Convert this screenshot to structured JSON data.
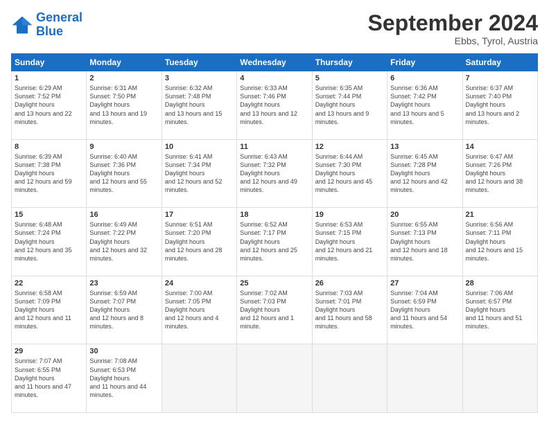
{
  "header": {
    "logo_line1": "General",
    "logo_line2": "Blue",
    "month": "September 2024",
    "location": "Ebbs, Tyrol, Austria"
  },
  "days_of_week": [
    "Sunday",
    "Monday",
    "Tuesday",
    "Wednesday",
    "Thursday",
    "Friday",
    "Saturday"
  ],
  "weeks": [
    [
      {
        "day": "1",
        "sunrise": "6:29 AM",
        "sunset": "7:52 PM",
        "daylight": "13 hours and 22 minutes."
      },
      {
        "day": "2",
        "sunrise": "6:31 AM",
        "sunset": "7:50 PM",
        "daylight": "13 hours and 19 minutes."
      },
      {
        "day": "3",
        "sunrise": "6:32 AM",
        "sunset": "7:48 PM",
        "daylight": "13 hours and 15 minutes."
      },
      {
        "day": "4",
        "sunrise": "6:33 AM",
        "sunset": "7:46 PM",
        "daylight": "13 hours and 12 minutes."
      },
      {
        "day": "5",
        "sunrise": "6:35 AM",
        "sunset": "7:44 PM",
        "daylight": "13 hours and 9 minutes."
      },
      {
        "day": "6",
        "sunrise": "6:36 AM",
        "sunset": "7:42 PM",
        "daylight": "13 hours and 5 minutes."
      },
      {
        "day": "7",
        "sunrise": "6:37 AM",
        "sunset": "7:40 PM",
        "daylight": "13 hours and 2 minutes."
      }
    ],
    [
      {
        "day": "8",
        "sunrise": "6:39 AM",
        "sunset": "7:38 PM",
        "daylight": "12 hours and 59 minutes."
      },
      {
        "day": "9",
        "sunrise": "6:40 AM",
        "sunset": "7:36 PM",
        "daylight": "12 hours and 55 minutes."
      },
      {
        "day": "10",
        "sunrise": "6:41 AM",
        "sunset": "7:34 PM",
        "daylight": "12 hours and 52 minutes."
      },
      {
        "day": "11",
        "sunrise": "6:43 AM",
        "sunset": "7:32 PM",
        "daylight": "12 hours and 49 minutes."
      },
      {
        "day": "12",
        "sunrise": "6:44 AM",
        "sunset": "7:30 PM",
        "daylight": "12 hours and 45 minutes."
      },
      {
        "day": "13",
        "sunrise": "6:45 AM",
        "sunset": "7:28 PM",
        "daylight": "12 hours and 42 minutes."
      },
      {
        "day": "14",
        "sunrise": "6:47 AM",
        "sunset": "7:26 PM",
        "daylight": "12 hours and 38 minutes."
      }
    ],
    [
      {
        "day": "15",
        "sunrise": "6:48 AM",
        "sunset": "7:24 PM",
        "daylight": "12 hours and 35 minutes."
      },
      {
        "day": "16",
        "sunrise": "6:49 AM",
        "sunset": "7:22 PM",
        "daylight": "12 hours and 32 minutes."
      },
      {
        "day": "17",
        "sunrise": "6:51 AM",
        "sunset": "7:20 PM",
        "daylight": "12 hours and 28 minutes."
      },
      {
        "day": "18",
        "sunrise": "6:52 AM",
        "sunset": "7:17 PM",
        "daylight": "12 hours and 25 minutes."
      },
      {
        "day": "19",
        "sunrise": "6:53 AM",
        "sunset": "7:15 PM",
        "daylight": "12 hours and 21 minutes."
      },
      {
        "day": "20",
        "sunrise": "6:55 AM",
        "sunset": "7:13 PM",
        "daylight": "12 hours and 18 minutes."
      },
      {
        "day": "21",
        "sunrise": "6:56 AM",
        "sunset": "7:11 PM",
        "daylight": "12 hours and 15 minutes."
      }
    ],
    [
      {
        "day": "22",
        "sunrise": "6:58 AM",
        "sunset": "7:09 PM",
        "daylight": "12 hours and 11 minutes."
      },
      {
        "day": "23",
        "sunrise": "6:59 AM",
        "sunset": "7:07 PM",
        "daylight": "12 hours and 8 minutes."
      },
      {
        "day": "24",
        "sunrise": "7:00 AM",
        "sunset": "7:05 PM",
        "daylight": "12 hours and 4 minutes."
      },
      {
        "day": "25",
        "sunrise": "7:02 AM",
        "sunset": "7:03 PM",
        "daylight": "12 hours and 1 minute."
      },
      {
        "day": "26",
        "sunrise": "7:03 AM",
        "sunset": "7:01 PM",
        "daylight": "11 hours and 58 minutes."
      },
      {
        "day": "27",
        "sunrise": "7:04 AM",
        "sunset": "6:59 PM",
        "daylight": "11 hours and 54 minutes."
      },
      {
        "day": "28",
        "sunrise": "7:06 AM",
        "sunset": "6:57 PM",
        "daylight": "11 hours and 51 minutes."
      }
    ],
    [
      {
        "day": "29",
        "sunrise": "7:07 AM",
        "sunset": "6:55 PM",
        "daylight": "11 hours and 47 minutes."
      },
      {
        "day": "30",
        "sunrise": "7:08 AM",
        "sunset": "6:53 PM",
        "daylight": "11 hours and 44 minutes."
      },
      null,
      null,
      null,
      null,
      null
    ]
  ]
}
